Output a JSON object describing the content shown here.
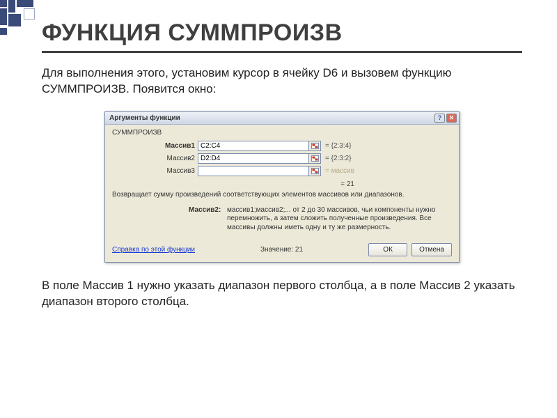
{
  "slide": {
    "title": "ФУНКЦИЯ СУММПРОИЗВ",
    "intro": "Для выполнения этого, установим курсор в ячейку  D6 и вызовем функцию СУММПРОИЗВ. Появится окно:",
    "outro": "В поле Массив 1 нужно указать диапазон первого столбца, а в поле Массив 2 указать диапазон второго столбца."
  },
  "dialog": {
    "title": "Аргументы функции",
    "help_glyph": "?",
    "close_glyph": "✕",
    "function_name": "СУММПРОИЗВ",
    "args": [
      {
        "label": "Массив1",
        "bold": true,
        "value": "C2:C4",
        "eval": "= {2:3:4}",
        "placeholder": false
      },
      {
        "label": "Массив2",
        "bold": false,
        "value": "D2:D4",
        "eval": "= {2:3:2}",
        "placeholder": false
      },
      {
        "label": "Массив3",
        "bold": false,
        "value": "",
        "eval": "= массив",
        "placeholder": true
      }
    ],
    "result_line": "= 21",
    "description": "Возвращает сумму произведений соответствующих элементов массивов или диапазонов.",
    "arg_help": {
      "label": "Массив2:",
      "text": "массив1;массив2;... от 2 до 30 массивов, чьи компоненты нужно перемножить, а затем сложить полученные произведения. Все массивы должны иметь одну и ту же размерность."
    },
    "footer": {
      "help_link": "Справка по этой функции",
      "value_label": "Значение:",
      "value": "21",
      "ok": "ОК",
      "cancel": "Отмена"
    }
  }
}
